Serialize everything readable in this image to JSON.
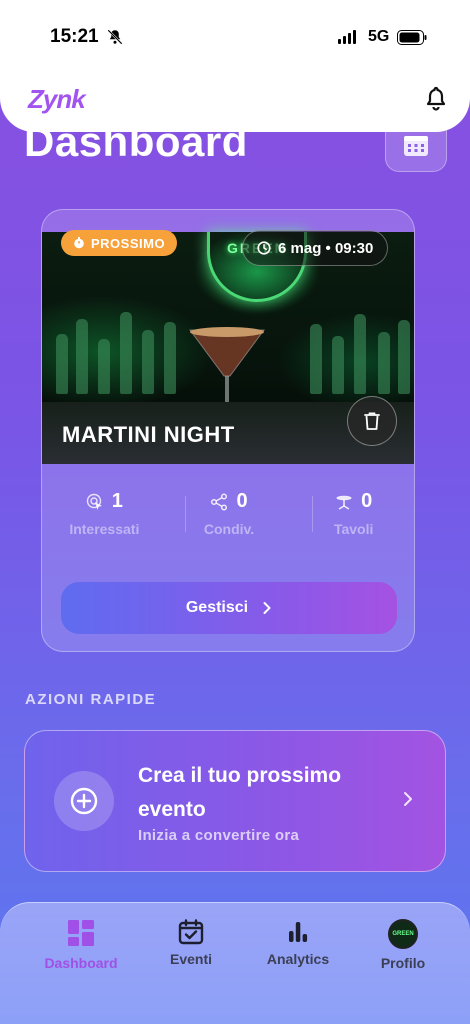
{
  "status_bar": {
    "time": "15:21",
    "network": "5G"
  },
  "header": {
    "logo": "Zynk"
  },
  "page": {
    "title": "Dashboard"
  },
  "event": {
    "badge": "PROSSIMO",
    "datetime": "6 mag • 09:30",
    "name": "MARTINI NIGHT",
    "sign_text": "GREEN",
    "stats": [
      {
        "icon": "tap-icon",
        "value": "1",
        "label": "Interessati"
      },
      {
        "icon": "share-icon",
        "value": "0",
        "label": "Condiv."
      },
      {
        "icon": "table-icon",
        "value": "0",
        "label": "Tavoli"
      }
    ],
    "manage_label": "Gestisci"
  },
  "quick_actions": {
    "title": "AZIONI RAPIDE",
    "create": {
      "title": "Crea il tuo prossimo evento",
      "subtitle": "Inizia a convertire ora"
    }
  },
  "tabs": [
    {
      "label": "Dashboard",
      "icon": "grid-icon",
      "active": true
    },
    {
      "label": "Eventi",
      "icon": "calendar-check-icon",
      "active": false
    },
    {
      "label": "Analytics",
      "icon": "bar-chart-icon",
      "active": false
    },
    {
      "label": "Profilo",
      "icon": "avatar",
      "active": false
    }
  ],
  "colors": {
    "accent": "#a254f0",
    "badge": "#f6a13a"
  }
}
